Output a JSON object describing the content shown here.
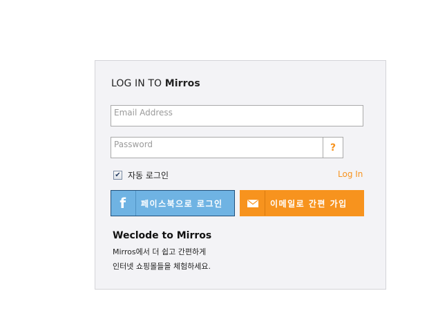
{
  "login": {
    "title_prefix": "LOG IN TO",
    "title_brand": "Mirros",
    "email_placeholder": "Email Address",
    "password_placeholder": "Password",
    "help_label": "?",
    "remember_label": "자동 로그인",
    "remember_checked": true,
    "login_link": "Log In"
  },
  "buttons": {
    "facebook": {
      "label": "페이스북으로 로그인",
      "icon": "facebook-icon",
      "color": "#6fb3e3"
    },
    "email_signup": {
      "label": "이메일로 간편 가입",
      "icon": "mail-icon",
      "color": "#f7931e"
    }
  },
  "welcome": {
    "heading": "Weclode to Mirros",
    "line1": "Mirros에서 더 쉽고 간편하게",
    "line2": "인터넷 쇼핑몰들을 체험하세요."
  },
  "colors": {
    "accent": "#f7931e",
    "panel_bg": "#f3f3f6"
  }
}
